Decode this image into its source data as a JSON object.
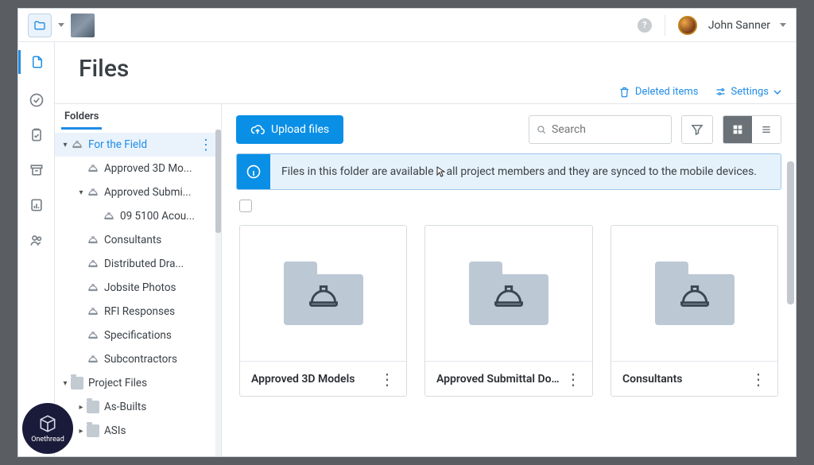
{
  "topbar": {
    "username": "John Sanner"
  },
  "page": {
    "title": "Files",
    "folders_tab": "Folders"
  },
  "actions": {
    "deleted": "Deleted items",
    "settings": "Settings",
    "upload": "Upload files",
    "search_placeholder": "Search"
  },
  "banner": {
    "pre": "Files in this folder are available ",
    "mid": "to",
    "post": " all project members and they are synced to the mobile devices."
  },
  "tree": {
    "root_label": "For the Field",
    "items": [
      {
        "label": "Approved 3D Mo...",
        "depth": 1
      },
      {
        "label": "Approved Submi...",
        "depth": 1,
        "expanded": true
      },
      {
        "label": "09 5100 Acou...",
        "depth": 2
      },
      {
        "label": "Consultants",
        "depth": 1
      },
      {
        "label": "Distributed Dra...",
        "depth": 1
      },
      {
        "label": "Jobsite Photos",
        "depth": 1
      },
      {
        "label": "RFI Responses",
        "depth": 1
      },
      {
        "label": "Specifications",
        "depth": 1
      },
      {
        "label": "Subcontractors",
        "depth": 1
      }
    ],
    "proj_label": "Project Files",
    "proj_children": [
      {
        "label": "As-Builts"
      },
      {
        "label": "ASIs"
      }
    ]
  },
  "cards": [
    {
      "name": "Approved 3D Models"
    },
    {
      "name": "Approved Submittal Docs"
    },
    {
      "name": "Consultants"
    }
  ],
  "brand": {
    "name": "Onethread"
  }
}
